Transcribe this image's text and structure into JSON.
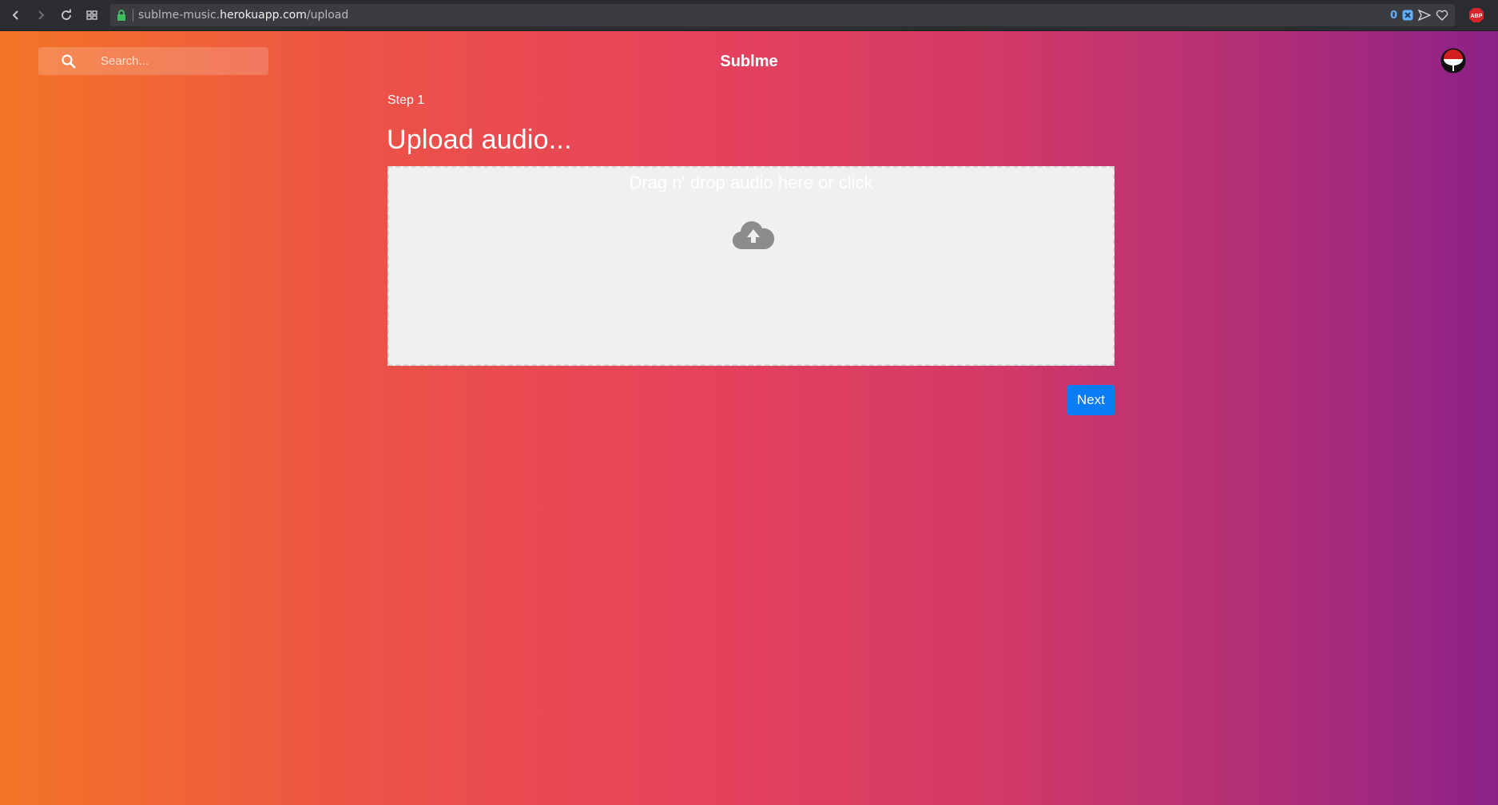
{
  "browser": {
    "url_prefix": "sublme-music.",
    "url_host": "herokuapp.com",
    "url_path": "/upload",
    "extension_badge_count": "0",
    "abp_label": "ABP"
  },
  "header": {
    "brand": "Sublme",
    "search": {
      "placeholder": "Search...",
      "value": ""
    }
  },
  "upload": {
    "step_label": "Step 1",
    "heading": "Upload audio...",
    "dropzone_text": "Drag n' drop audio here or click",
    "next_label": "Next"
  },
  "colors": {
    "gradient_start": "#f47427",
    "gradient_mid": "#e7435a",
    "gradient_end": "#8c2188",
    "button_blue": "#0a7cf6"
  },
  "icons": {
    "search": "search-icon",
    "upload": "cloud-upload-icon",
    "avatar": "uchiha-fan-icon"
  }
}
